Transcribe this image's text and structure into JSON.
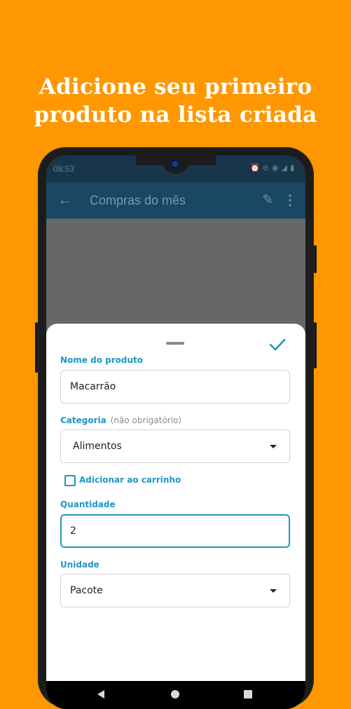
{
  "headline": {
    "line1": "Adicione seu primeiro",
    "line2": "produto na lista criada"
  },
  "status_bar": {
    "time": "08:53",
    "icons": [
      "alarm-icon",
      "dnd-icon",
      "wifi-icon",
      "signal-icon",
      "battery-icon"
    ]
  },
  "app_bar": {
    "title": "Compras do mês",
    "back_icon": "arrow-back-icon",
    "edit_icon": "pencil-icon",
    "more_icon": "more-vert-icon"
  },
  "form": {
    "product_name": {
      "label": "Nome do produto",
      "value": "Macarrão"
    },
    "category": {
      "label": "Categoria",
      "optional_note": "(não obrigatório)",
      "selected": "Alimentos"
    },
    "add_to_cart": {
      "label": "Adicionar ao carrinho",
      "checked": false
    },
    "quantity": {
      "label": "Quantidade",
      "value": "2"
    },
    "unit": {
      "label": "Unidade",
      "selected": "Pacote"
    }
  },
  "colors": {
    "background": "#FF9800",
    "accent": "#2196C4",
    "app_bar": "#1a4763"
  }
}
